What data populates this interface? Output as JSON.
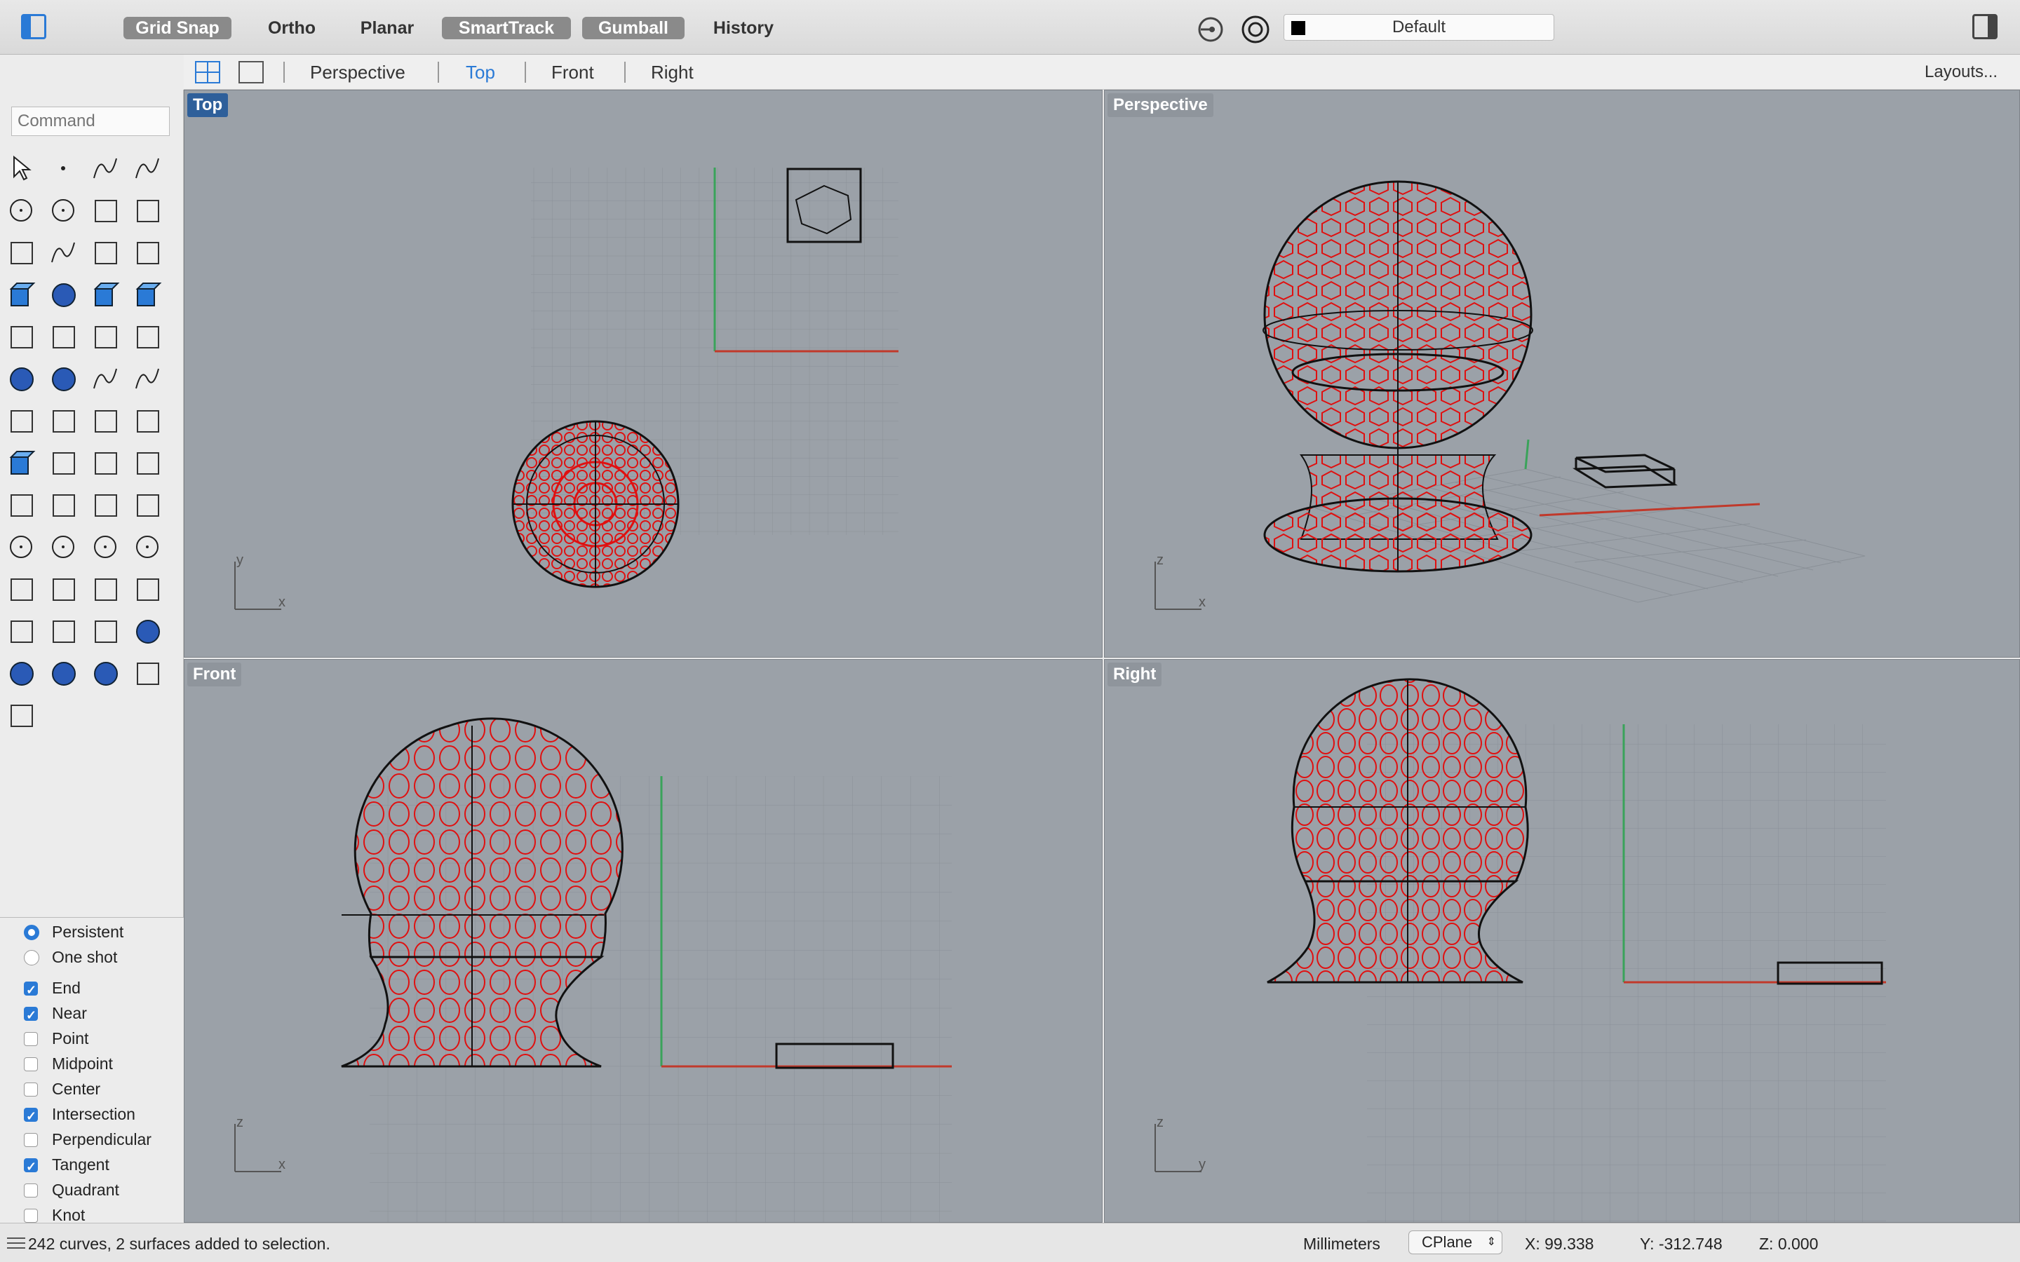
{
  "toolbar": {
    "grid_snap": "Grid Snap",
    "ortho": "Ortho",
    "planar": "Planar",
    "smarttrack": "SmartTrack",
    "gumball": "Gumball",
    "history": "History",
    "layer": "Default",
    "layer_color": "#000000"
  },
  "tabs": {
    "perspective": "Perspective",
    "top": "Top",
    "front": "Front",
    "right": "Right",
    "layouts": "Layouts..."
  },
  "command": {
    "placeholder": "Command"
  },
  "tools": [
    "select-arrow",
    "point",
    "polyline",
    "curve",
    "circle",
    "ellipse",
    "polygon-line",
    "rectangle",
    "polygon",
    "fillet-curve",
    "surface-edit",
    "surface-sweep",
    "box",
    "boolean-spheres",
    "cylinder",
    "extrude-surface",
    "explode",
    "split",
    "trim",
    "extend",
    "boolean-union",
    "boolean-spheres-group",
    "rotate-curve",
    "offset-curve",
    "text",
    "scale",
    "array",
    "orient",
    "solid-box-blue",
    "dimension",
    "grid-array",
    "transform",
    "loft",
    "check",
    "shell",
    "paint",
    "zoom-in",
    "zoom-window",
    "zoom-extents",
    "zoom-selected",
    "rotate-view",
    "car",
    "grid-plane",
    "named-views",
    "light",
    "lock",
    "layer",
    "color-wheel",
    "wireframe-sphere",
    "ghosted-sphere",
    "shaded-sphere",
    "render-cone",
    "block"
  ],
  "osnap": {
    "persistent": "Persistent",
    "one_shot": "One shot",
    "items": [
      {
        "label": "End",
        "checked": true
      },
      {
        "label": "Near",
        "checked": true
      },
      {
        "label": "Point",
        "checked": false
      },
      {
        "label": "Midpoint",
        "checked": false
      },
      {
        "label": "Center",
        "checked": false
      },
      {
        "label": "Intersection",
        "checked": true
      },
      {
        "label": "Perpendicular",
        "checked": false
      },
      {
        "label": "Tangent",
        "checked": true
      },
      {
        "label": "Quadrant",
        "checked": false
      },
      {
        "label": "Knot",
        "checked": false
      }
    ]
  },
  "viewports": {
    "top": "Top",
    "perspective": "Perspective",
    "front": "Front",
    "right": "Right",
    "axis_x": "x",
    "axis_y": "y",
    "axis_z": "z"
  },
  "status": {
    "message": "242 curves, 2 surfaces added to selection.",
    "units": "Millimeters",
    "cplane": "CPlane",
    "x": "X: 99.338",
    "y": "Y: -312.748",
    "z": "Z: 0.000"
  },
  "colors": {
    "accent": "#2a7ad6",
    "viewport_bg": "#9ba1a8",
    "selection": "#e00000",
    "x_axis": "#c0392b",
    "y_axis": "#3aa35a"
  }
}
